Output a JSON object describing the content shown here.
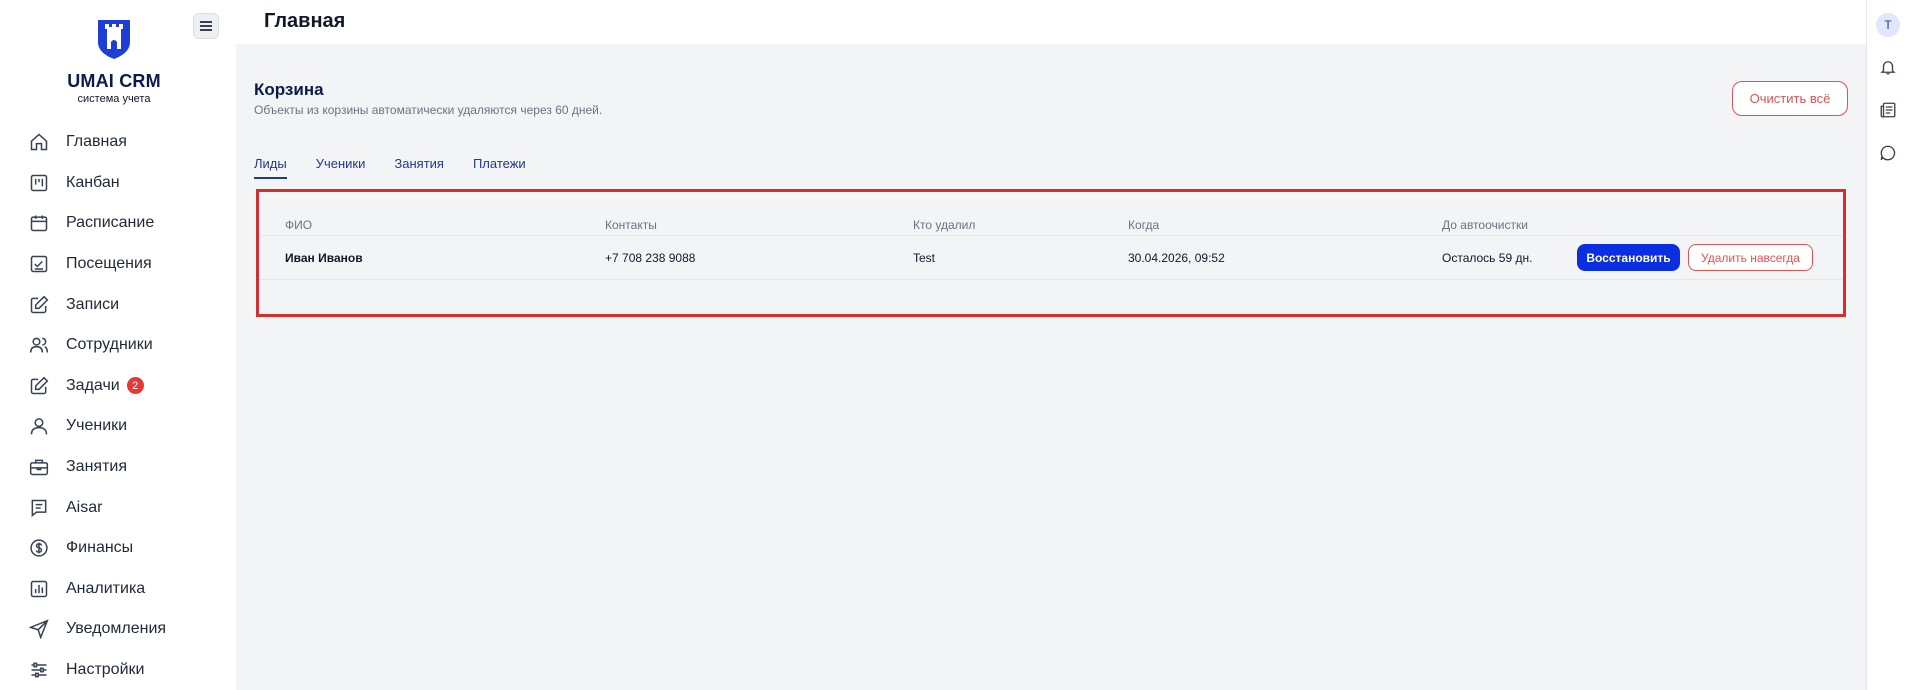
{
  "brand": {
    "name": "UMAI CRM",
    "subtitle": "система учета",
    "color": "#0d1b4c"
  },
  "page_title": "Главная",
  "sidebar": {
    "items": [
      {
        "label": "Главная",
        "icon": "home-icon"
      },
      {
        "label": "Канбан",
        "icon": "kanban-icon"
      },
      {
        "label": "Расписание",
        "icon": "calendar-icon"
      },
      {
        "label": "Посещения",
        "icon": "attendance-icon"
      },
      {
        "label": "Записи",
        "icon": "edit-icon"
      },
      {
        "label": "Сотрудники",
        "icon": "users-icon"
      },
      {
        "label": "Задачи",
        "icon": "tasks-icon",
        "badge": "2"
      },
      {
        "label": "Ученики",
        "icon": "user-icon"
      },
      {
        "label": "Занятия",
        "icon": "briefcase-icon"
      },
      {
        "label": "Aisar",
        "icon": "chat-doc-icon"
      },
      {
        "label": "Финансы",
        "icon": "dollar-icon"
      },
      {
        "label": "Аналитика",
        "icon": "chart-icon"
      },
      {
        "label": "Уведомления",
        "icon": "send-icon"
      },
      {
        "label": "Настройки",
        "icon": "sliders-icon"
      }
    ]
  },
  "trash": {
    "title": "Корзина",
    "subtitle": "Объекты из корзины автоматически удаляются через 60 дней.",
    "clear_all_label": "Очистить всё",
    "tabs": [
      {
        "label": "Лиды",
        "active": true
      },
      {
        "label": "Ученики",
        "active": false
      },
      {
        "label": "Занятия",
        "active": false
      },
      {
        "label": "Платежи",
        "active": false
      }
    ],
    "columns": [
      "ФИО",
      "Контакты",
      "Кто удалил",
      "Когда",
      "До автоочистки"
    ],
    "rows": [
      {
        "name": "Иван Иванов",
        "contacts": "+7 708 238 9088",
        "deleted_by": "Test",
        "when": "30.04.2026, 09:52",
        "remaining": "Осталось 59 дн.",
        "restore_label": "Восстановить",
        "delete_label": "Удалить навсегда"
      }
    ]
  },
  "rail": {
    "avatar_letter": "T"
  },
  "colors": {
    "accent": "#0a2fe0",
    "danger": "#e05252",
    "highlight": "#d32f2f"
  }
}
